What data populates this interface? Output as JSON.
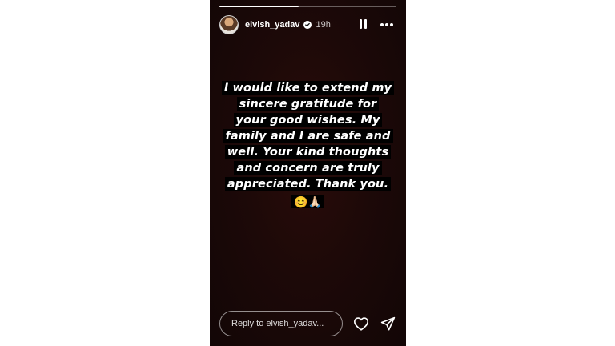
{
  "story": {
    "progress_fraction": 0.45,
    "header": {
      "username": "elvish_yadav",
      "time_ago": "19h",
      "avatar_icon": "profile-photo",
      "verified_icon": "verified-badge-icon",
      "pause_icon": "pause-icon",
      "more_icon": "more-options-icon"
    },
    "message": {
      "text": "I would like to extend my sincere gratitude for your good wishes. My family and I are safe and well. Your kind thoughts and concern are truly appreciated. Thank you.",
      "emojis": "😊🙏🏻"
    },
    "footer": {
      "reply_placeholder": "Reply to elvish_yadav...",
      "like_icon": "heart-icon",
      "share_icon": "send-icon"
    }
  },
  "colors": {
    "page_background": "#ffffff",
    "story_background": "#1d0908",
    "text": "#ffffff",
    "text_highlight": "#000000"
  }
}
